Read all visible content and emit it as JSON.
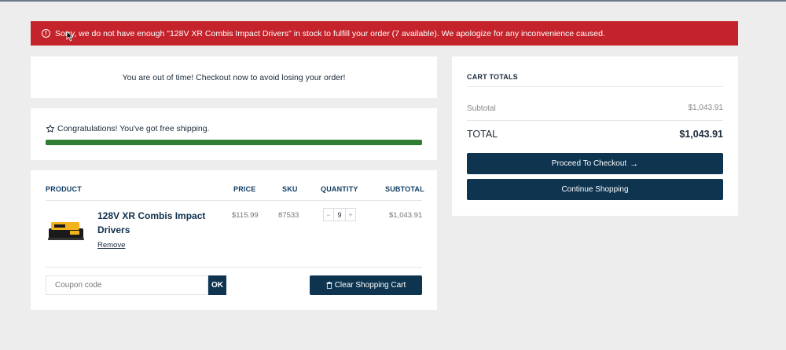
{
  "alert": {
    "message": "Sorry, we do not have enough \"128V XR Combis Impact Drivers\" in stock to fulfill your order (7 available). We apologize for any inconvenience caused.",
    "icon": "info-icon",
    "color": "#c4232b"
  },
  "timer": {
    "message": "You are out of time! Checkout now to avoid losing your order!"
  },
  "shipping": {
    "message": "Congratulations! You've got free shipping.",
    "icon": "star-icon",
    "progress": 1.0,
    "bar_color": "#2e7d32"
  },
  "cart": {
    "headers": {
      "product": "PRODUCT",
      "price": "PRICE",
      "sku": "SKU",
      "quantity": "QUANTITY",
      "subtotal": "SUBTOTAL"
    },
    "items": [
      {
        "name": "128V XR Combis Impact Drivers",
        "remove_label": "Remove",
        "price": "$115.99",
        "sku": "87533",
        "quantity": "9",
        "subtotal": "$1,043.91"
      }
    ],
    "coupon": {
      "placeholder": "Coupon code",
      "value": "",
      "apply_label": "OK"
    },
    "clear_label": "Clear Shopping Cart"
  },
  "totals": {
    "title": "CART TOTALS",
    "subtotal_label": "Subtotal",
    "subtotal_value": "$1,043.91",
    "total_label": "TOTAL",
    "total_value": "$1,043.91",
    "checkout_label": "Proceed To Checkout",
    "continue_label": "Continue Shopping"
  },
  "colors": {
    "primary": "#0e3450",
    "background": "#ededee"
  }
}
